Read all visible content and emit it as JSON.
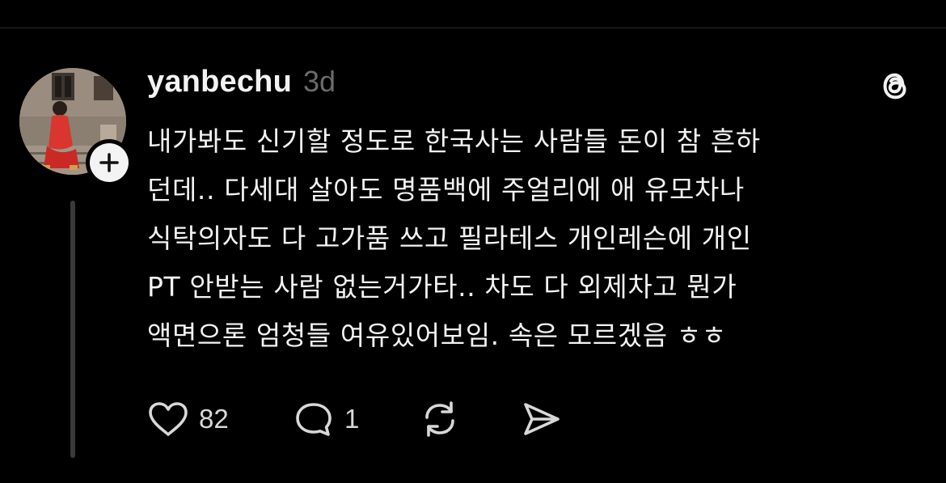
{
  "post": {
    "username": "yanbechu",
    "time": "3d",
    "lines": [
      "내가봐도 신기할 정도로 한국사는 사람들 돈이 참 흔하",
      "던데.. 다세대 살아도 명품백에 주얼리에 애 유모차나",
      "식탁의자도 다 고가품 쓰고 필라테스 개인레슨에 개인",
      "PT 안받는 사람 없는거가타.. 차도 다 외제차고 뭔가",
      "액면으론 엄청들 여유있어보임. 속은 모르겠음 ㅎㅎ"
    ],
    "likes": "82",
    "replies": "1"
  },
  "icons": {
    "follow": "plus-icon",
    "logo": "threads-logo-icon",
    "like": "heart-icon",
    "reply": "speech-bubble-icon",
    "repost": "repost-icon",
    "share": "send-icon"
  },
  "colors": {
    "background": "#000000",
    "text": "#f3f3f3",
    "muted": "#6b6b6b",
    "thread_line": "#3a3a3a"
  }
}
